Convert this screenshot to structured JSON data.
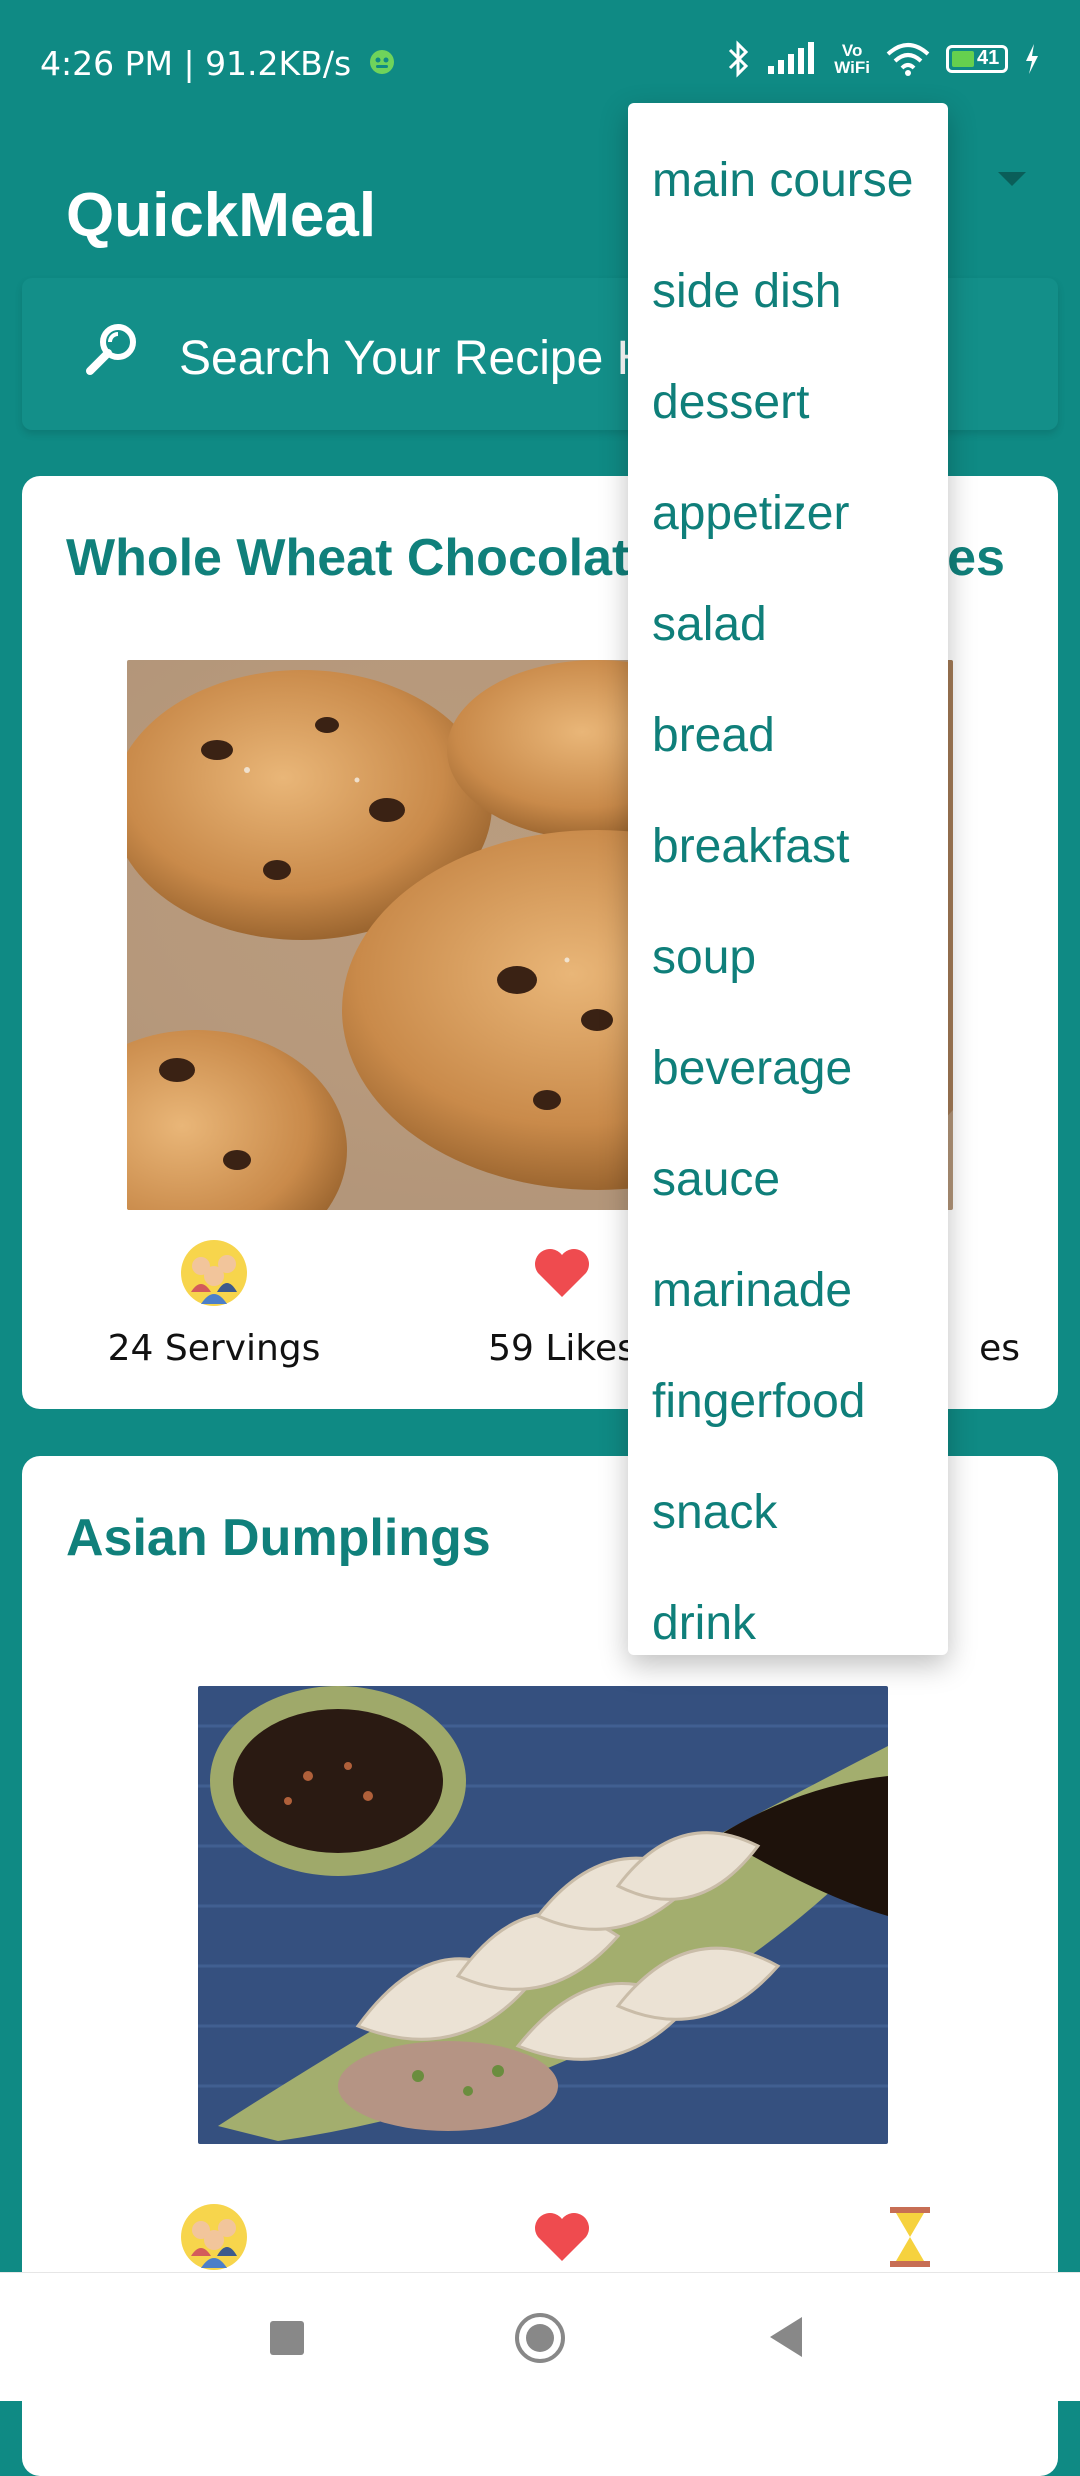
{
  "status_bar": {
    "time_speed": "4:26 PM | 91.2KB/s",
    "battery": "41",
    "volte_top": "Vo",
    "volte_bottom": "WiFi"
  },
  "app": {
    "title": "QuickMeal"
  },
  "search": {
    "placeholder": "Search Your Recipe Here"
  },
  "recipes": [
    {
      "title": "Whole Wheat Chocolate Chip Cookies",
      "servings": "24 Servings",
      "likes": "59 Likes",
      "time": "45 Minutes",
      "time_visible": "es"
    },
    {
      "title": "Asian Dumplings"
    }
  ],
  "menu": {
    "items": [
      "main course",
      "side dish",
      "dessert",
      "appetizer",
      "salad",
      "bread",
      "breakfast",
      "soup",
      "beverage",
      "sauce",
      "marinade",
      "fingerfood",
      "snack",
      "drink"
    ]
  },
  "colors": {
    "primary": "#0f8a84",
    "accent_text": "#10807b",
    "heart": "#ef4b4f"
  }
}
